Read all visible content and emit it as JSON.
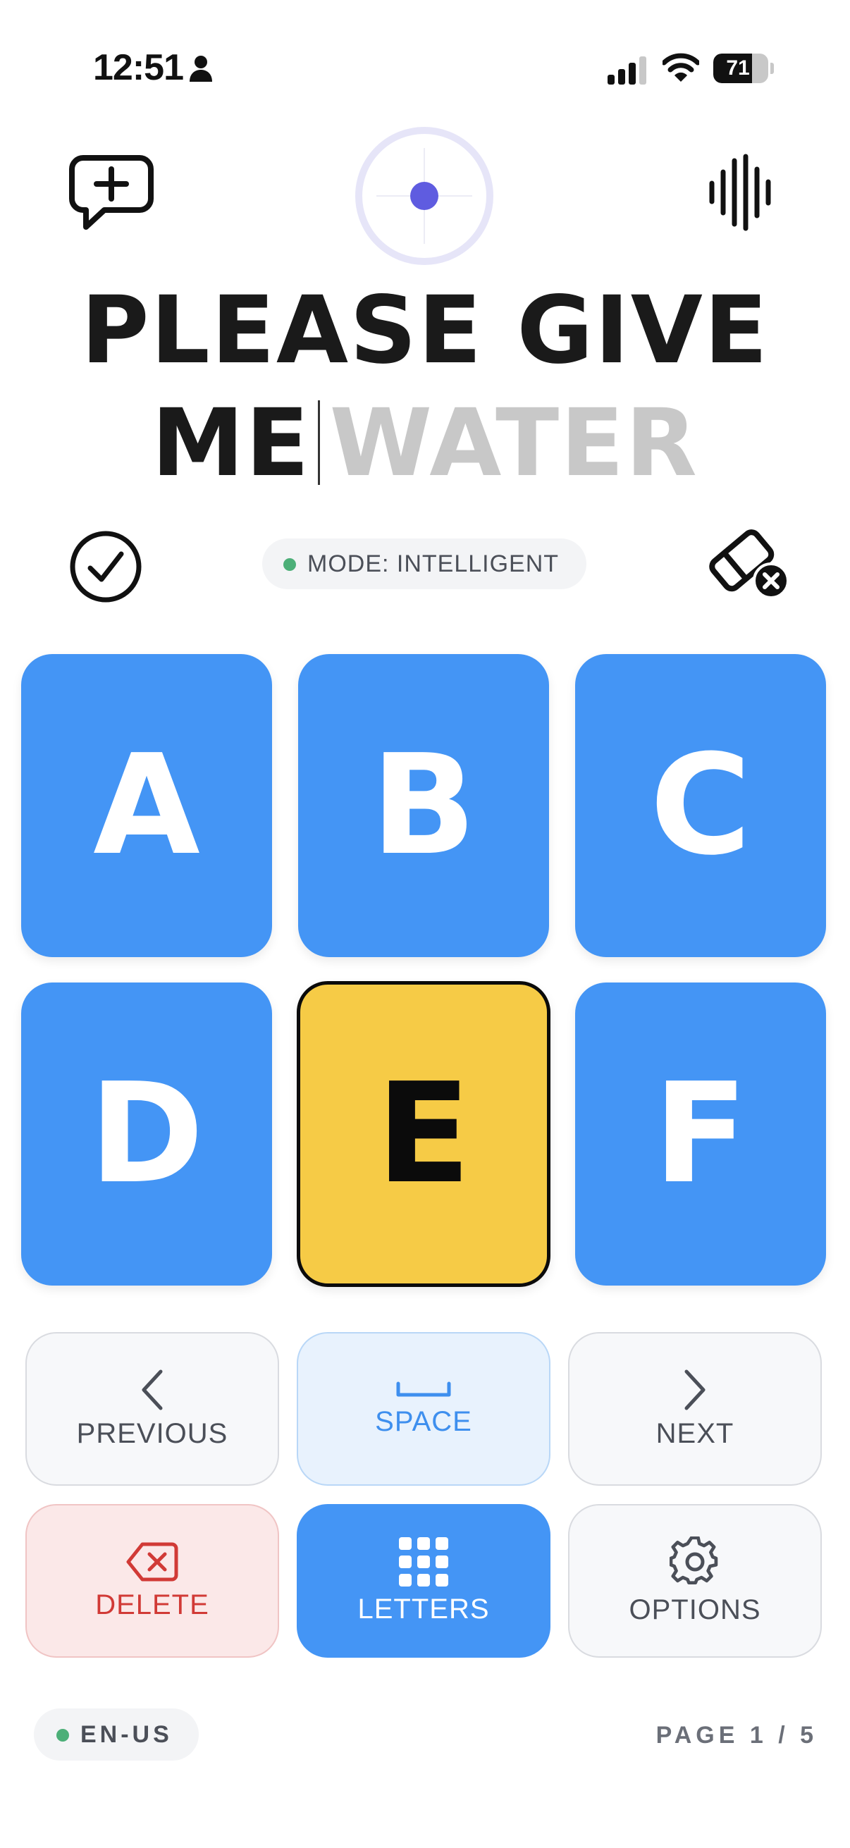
{
  "status_bar": {
    "time": "12:51",
    "battery_percent": "71",
    "battery_level": 0.71
  },
  "sentence": {
    "line1": "PLEASE GIVE",
    "typed": "ME",
    "prediction": "WATER"
  },
  "mode": {
    "label": "MODE: INTELLIGENT"
  },
  "keys": [
    "A",
    "B",
    "C",
    "D",
    "E",
    "F"
  ],
  "active_key": "E",
  "actions": {
    "previous": "PREVIOUS",
    "space": "SPACE",
    "next": "NEXT",
    "delete": "DELETE",
    "letters": "LETTERS",
    "options": "OPTIONS"
  },
  "footer": {
    "language": "EN-US",
    "page": "PAGE 1 / 5"
  },
  "colors": {
    "key_blue": "#4495f5",
    "key_active": "#f6cb46",
    "status_green": "#4caf78",
    "delete_red": "#d13a36",
    "target_dot": "#5f5ce0"
  },
  "icons": [
    "person-icon",
    "signal-icon",
    "wifi-icon",
    "new-chat-icon",
    "voice-wave-icon",
    "check-circle-icon",
    "eraser-icon",
    "chevron-left-icon",
    "space-bar-icon",
    "chevron-right-icon",
    "backspace-icon",
    "grid-icon",
    "gear-icon"
  ]
}
